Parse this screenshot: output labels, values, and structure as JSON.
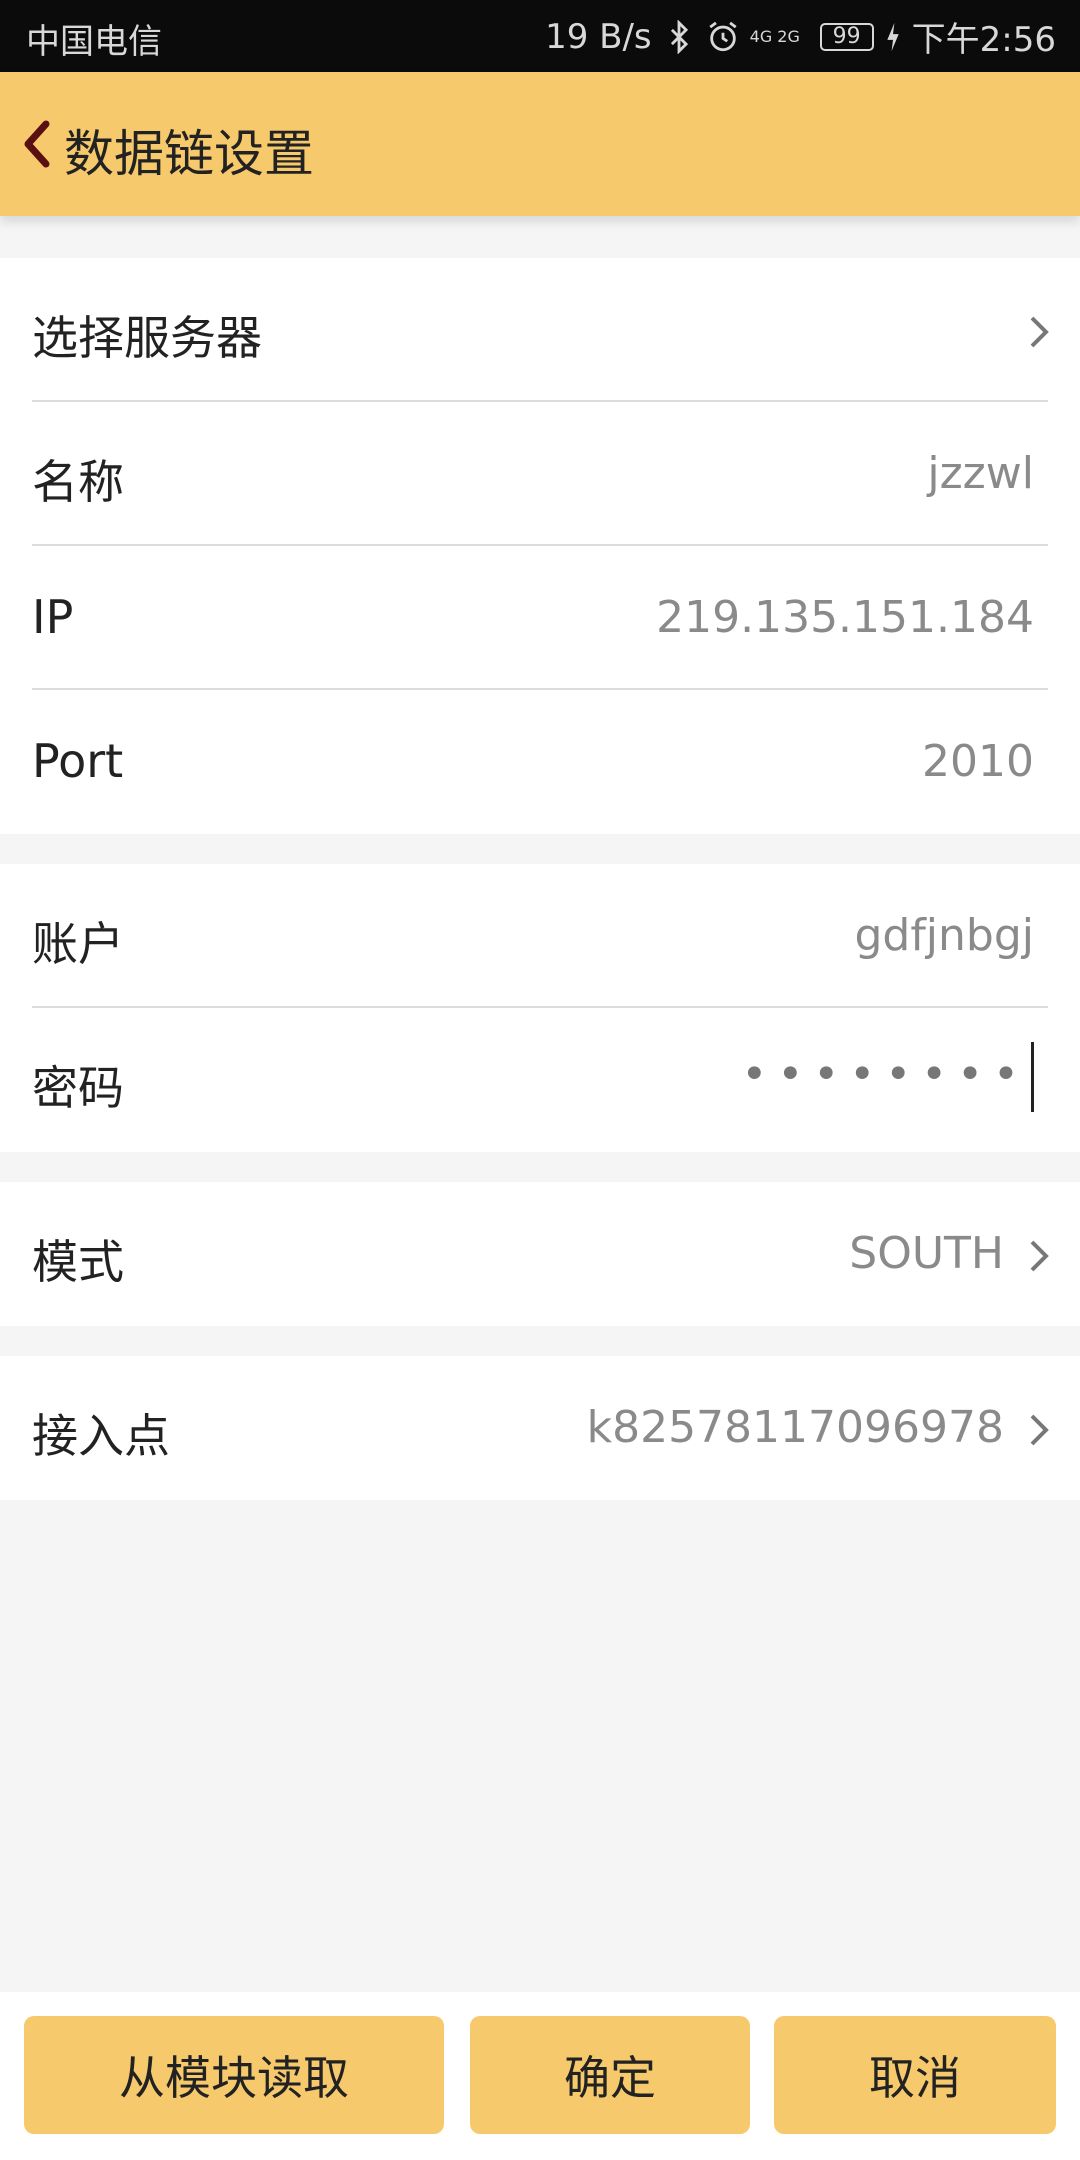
{
  "status_bar": {
    "carrier": "中国电信",
    "speed": "19 B/s",
    "network": "4G 2G",
    "battery": "99",
    "time": "下午2:56",
    "icons": [
      "bluetooth-icon",
      "alarm-icon",
      "signal-icon",
      "battery-icon",
      "charging-icon"
    ]
  },
  "header": {
    "title": "数据链设置",
    "back_icon": "chevron-left-icon",
    "color": "#f6c96c"
  },
  "groups": [
    {
      "rows": [
        {
          "label": "选择服务器",
          "value": "",
          "chevron": true
        },
        {
          "label": "名称",
          "value": "jzzwl",
          "chevron": false
        },
        {
          "label": "IP",
          "value": "219.135.151.184",
          "chevron": false
        },
        {
          "label": "Port",
          "value": "2010",
          "chevron": false
        }
      ]
    },
    {
      "rows": [
        {
          "label": "账户",
          "value": "gdfjnbgj",
          "chevron": false
        },
        {
          "label": "密码",
          "value": "••••••••",
          "chevron": false
        }
      ]
    },
    {
      "rows": [
        {
          "label": "模式",
          "value": "SOUTH",
          "chevron": true
        }
      ]
    },
    {
      "rows": [
        {
          "label": "接入点",
          "value": "k82578117096978",
          "chevron": true
        }
      ]
    }
  ],
  "buttons": {
    "read_from_module": "从模块读取",
    "confirm": "确定",
    "cancel": "取消"
  }
}
